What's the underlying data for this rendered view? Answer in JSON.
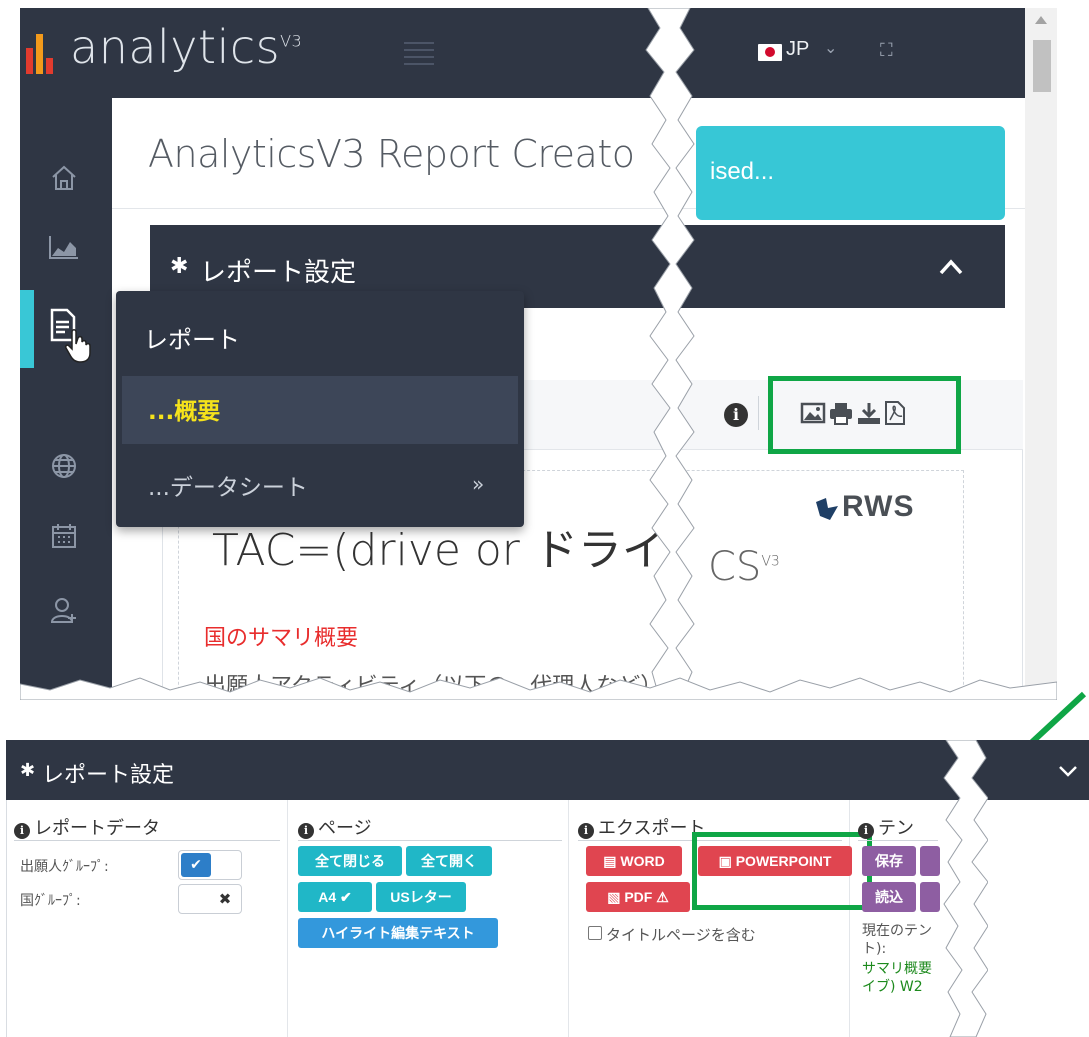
{
  "app": {
    "logo_text": "analytics",
    "logo_version": "V3",
    "language": "JP",
    "lang_caret": "⌄",
    "fullscreen_icon": "⛶"
  },
  "header": {
    "page_title": "AnalyticsV3 Report Creato",
    "toast_text": "ised..."
  },
  "panel": {
    "title": "レポート設定",
    "caret_up": "^"
  },
  "sidebar_icons": [
    "home-icon",
    "chart-area-icon",
    "report-icon",
    "globe-icon",
    "calendar-icon",
    "user-add-icon"
  ],
  "popup_menu": {
    "header_label": "レポート",
    "items": [
      {
        "label": "...概要",
        "active": true
      },
      {
        "label": "...データシート",
        "chevron": "»"
      }
    ]
  },
  "report_preview": {
    "info_icon": "i",
    "brand": "RWS",
    "title_snippet": "TAC=(drive or ドライ",
    "subtitle_snippet": "CS",
    "subtitle_sup": "V3",
    "section_heading": "国のサマリ概要",
    "body_snippet": "出願人アクティビティ（以下の、代理人など）"
  },
  "bottom_panel": {
    "title": "レポート設定",
    "caret": "⌄",
    "sections": {
      "report_data": {
        "heading": "レポートデータ",
        "rows": [
          {
            "label": "出願人ｸﾞﾙｰﾌﾟ:",
            "state": "on",
            "glyph": "✔"
          },
          {
            "label": "国ｸﾞﾙｰﾌﾟ:",
            "state": "off",
            "glyph": "✖"
          }
        ]
      },
      "page": {
        "heading": "ページ",
        "collapse_all": "全て閉じる",
        "expand_all": "全て開く",
        "a4": "A4 ✔",
        "us_letter": "USレター",
        "highlight_edit": "ハイライト編集テキスト"
      },
      "export": {
        "heading": "エクスポート",
        "word": "WORD",
        "powerpoint": "POWERPOINT",
        "pdf": "PDF",
        "pdf_warn": "⚠",
        "include_title": "タイトルページを含む"
      },
      "template": {
        "heading": "テン",
        "save": "保存",
        "load": "読込",
        "current_label": "現在のテン",
        "current_label2": "ト):",
        "current_value": "サマリ概要",
        "current_value2": "イブ) W2"
      }
    }
  },
  "colors": {
    "dark_bg": "#2f3644",
    "accent_teal": "#37c7d6",
    "highlight_green": "#0fa646",
    "menu_active_text": "#f5e21b",
    "red_heading": "#e82d2d"
  }
}
